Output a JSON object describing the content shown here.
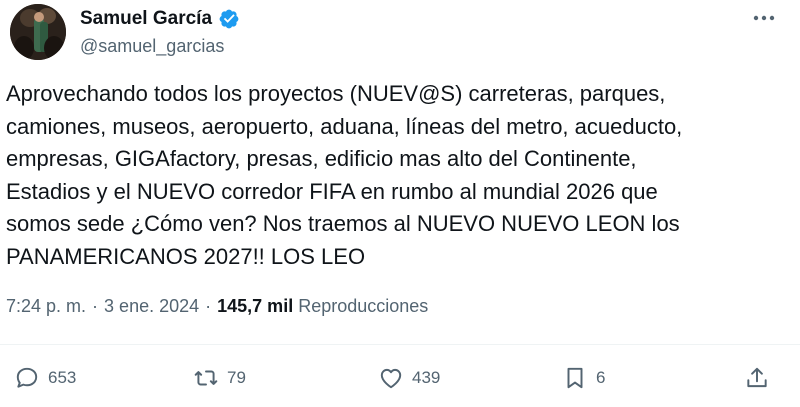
{
  "author": {
    "display_name": "Samuel García",
    "handle": "@samuel_garcias",
    "verified": true
  },
  "tweet": {
    "text_lines": [
      "Aprovechando todos los proyectos (NUEV@S) carreteras, parques,",
      "camiones, museos, aeropuerto, aduana, líneas del metro, acueducto,",
      "empresas, GIGAfactory, presas, edificio mas alto del Continente,",
      "Estadios y el NUEVO corredor FIFA en rumbo al mundial 2026 que",
      "somos sede ¿Cómo ven? Nos traemos al NUEVO NUEVO LEON los",
      "PANAMERICANOS 2027!! LOS LEO"
    ]
  },
  "meta": {
    "time": "7:24 p. m.",
    "separator": "·",
    "date": "3 ene. 2024",
    "separator2": "·",
    "views_count": "145,7 mil",
    "views_label": "Reproducciones"
  },
  "actions": {
    "reply_count": "653",
    "retweet_count": "79",
    "like_count": "439",
    "bookmark_count": "6"
  },
  "colors": {
    "text": "#0f1419",
    "secondary": "#536471",
    "verified": "#1d9bf0",
    "divider": "#eff3f4"
  },
  "icons": {
    "more": "more-horizontal-icon",
    "verified": "verified-badge-icon",
    "reply": "reply-icon",
    "retweet": "retweet-icon",
    "like": "heart-icon",
    "bookmark": "bookmark-icon",
    "share": "share-icon"
  }
}
